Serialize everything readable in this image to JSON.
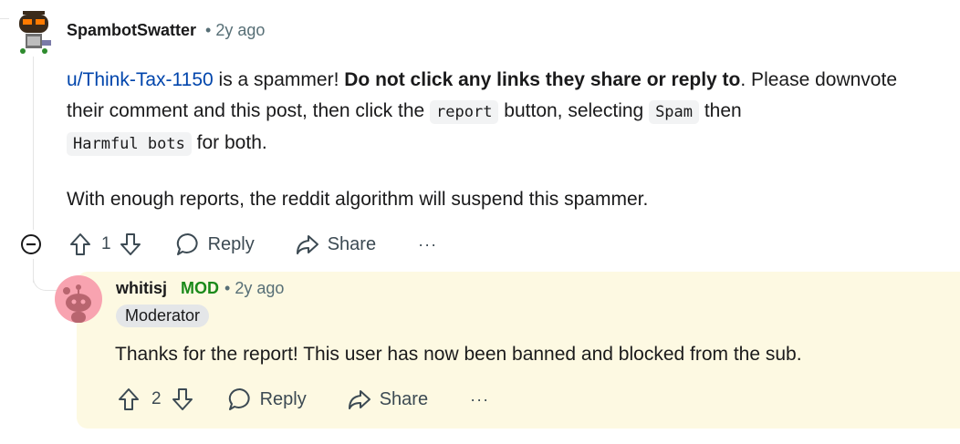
{
  "comment": {
    "username": "SpambotSwatter",
    "time": "• 2y ago",
    "mention": "u/Think-Tax-1150",
    "text_1": " is a spammer! ",
    "bold_text": "Do not click any links they share or reply to",
    "text_2": ". Please downvote their comment and this post, then click the ",
    "code_report": "report",
    "text_3": " button, selecting ",
    "code_spam": "Spam",
    "text_4": " then ",
    "code_harmful": "Harmful bots",
    "text_5": " for both.",
    "paragraph_2": "With enough reports, the reddit algorithm will suspend this spammer.",
    "votes": "1",
    "reply_label": "Reply",
    "share_label": "Share",
    "more_label": "···"
  },
  "reply": {
    "username": "whitisj",
    "mod_label": "MOD",
    "time": "• 2y ago",
    "flair": "Moderator",
    "text": "Thanks for the report! This user has now been banned and blocked from the sub.",
    "votes": "2",
    "reply_label": "Reply",
    "share_label": "Share",
    "more_label": "···"
  },
  "colors": {
    "link": "#0045ac",
    "mod": "#1b8a1b",
    "reply_background": "#fdf9e2"
  }
}
